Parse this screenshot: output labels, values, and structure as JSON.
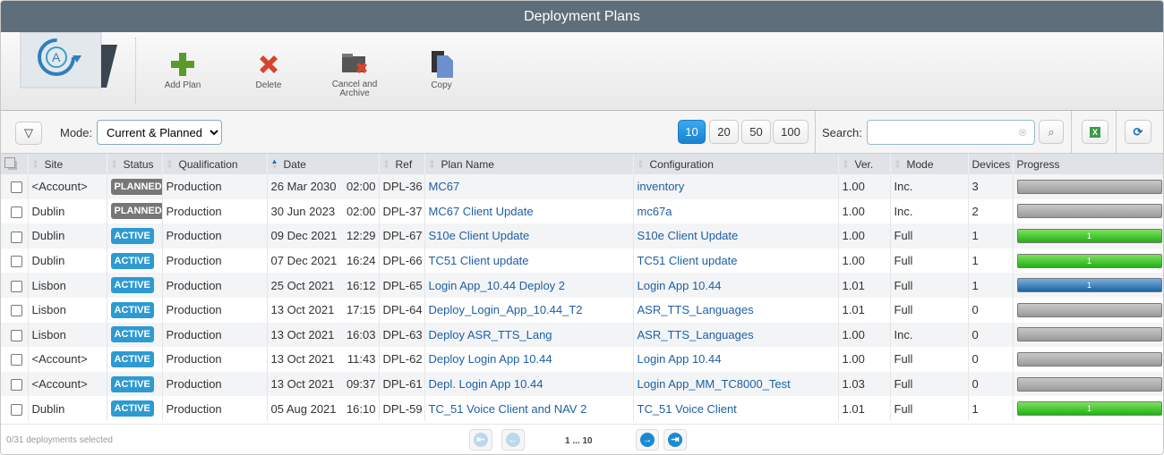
{
  "window": {
    "title": "Deployment Plans"
  },
  "toolbar": {
    "add": "Add Plan",
    "delete": "Delete",
    "cancel_archive": "Cancel and Archive",
    "copy": "Copy"
  },
  "filter": {
    "mode_label": "Mode:",
    "mode_value": "Current & Planned",
    "page_sizes": [
      "10",
      "20",
      "50",
      "100"
    ],
    "active_page_size": "10",
    "search_label": "Search:",
    "search_value": ""
  },
  "columns": [
    "Site",
    "Status",
    "Qualification",
    "Date",
    "Ref",
    "Plan Name",
    "Configuration",
    "Ver.",
    "Mode",
    "Devices",
    "Progress"
  ],
  "rows": [
    {
      "site": "<Account>",
      "status": "PLANNED",
      "qual": "Production",
      "date": "26 Mar 2030",
      "time": "02:00",
      "ref": "DPL-36",
      "plan": "MC67",
      "config": "inventory",
      "ver": "1.00",
      "mode": "Inc.",
      "devices": "3",
      "progress": {
        "state": "none",
        "fraction": 0,
        "label": ""
      }
    },
    {
      "site": "Dublin",
      "status": "PLANNED",
      "qual": "Production",
      "date": "30 Jun 2023",
      "time": "02:00",
      "ref": "DPL-37",
      "plan": "MC67 Client Update",
      "config": "mc67a",
      "ver": "1.00",
      "mode": "Inc.",
      "devices": "2",
      "progress": {
        "state": "none",
        "fraction": 0,
        "label": ""
      }
    },
    {
      "site": "Dublin",
      "status": "ACTIVE",
      "qual": "Production",
      "date": "09 Dec 2021",
      "time": "12:29",
      "ref": "DPL-67",
      "plan": "S10e Client Update",
      "config": "S10e Client Update",
      "ver": "1.00",
      "mode": "Full",
      "devices": "1",
      "progress": {
        "state": "green",
        "fraction": 1,
        "label": "1"
      }
    },
    {
      "site": "Dublin",
      "status": "ACTIVE",
      "qual": "Production",
      "date": "07 Dec 2021",
      "time": "16:24",
      "ref": "DPL-66",
      "plan": "TC51 Client update",
      "config": "TC51 Client update",
      "ver": "1.00",
      "mode": "Full",
      "devices": "1",
      "progress": {
        "state": "green",
        "fraction": 1,
        "label": "1"
      }
    },
    {
      "site": "Lisbon",
      "status": "ACTIVE",
      "qual": "Production",
      "date": "25 Oct 2021",
      "time": "16:12",
      "ref": "DPL-65",
      "plan": "Login App_10.44 Deploy 2",
      "config": "Login App 10.44",
      "ver": "1.01",
      "mode": "Full",
      "devices": "1",
      "progress": {
        "state": "blue",
        "fraction": 1,
        "label": "1"
      }
    },
    {
      "site": "Lisbon",
      "status": "ACTIVE",
      "qual": "Production",
      "date": "13 Oct 2021",
      "time": "17:15",
      "ref": "DPL-64",
      "plan": "Deploy_Login_App_10.44_T2",
      "config": "ASR_TTS_Languages",
      "ver": "1.01",
      "mode": "Full",
      "devices": "0",
      "progress": {
        "state": "none",
        "fraction": 0,
        "label": ""
      }
    },
    {
      "site": "Lisbon",
      "status": "ACTIVE",
      "qual": "Production",
      "date": "13 Oct 2021",
      "time": "16:03",
      "ref": "DPL-63",
      "plan": "Deploy ASR_TTS_Lang",
      "config": "ASR_TTS_Languages",
      "ver": "1.00",
      "mode": "Inc.",
      "devices": "0",
      "progress": {
        "state": "none",
        "fraction": 0,
        "label": ""
      }
    },
    {
      "site": "<Account>",
      "status": "ACTIVE",
      "qual": "Production",
      "date": "13 Oct 2021",
      "time": "11:43",
      "ref": "DPL-62",
      "plan": "Deploy Login App 10.44",
      "config": "Login App 10.44",
      "ver": "1.00",
      "mode": "Full",
      "devices": "0",
      "progress": {
        "state": "none",
        "fraction": 0,
        "label": ""
      }
    },
    {
      "site": "<Account>",
      "status": "ACTIVE",
      "qual": "Production",
      "date": "13 Oct 2021",
      "time": "09:37",
      "ref": "DPL-61",
      "plan": "Depl. Login App 10.44",
      "config": "Login App_MM_TC8000_Test",
      "ver": "1.03",
      "mode": "Full",
      "devices": "0",
      "progress": {
        "state": "none",
        "fraction": 0,
        "label": ""
      }
    },
    {
      "site": "Dublin",
      "status": "ACTIVE",
      "qual": "Production",
      "date": "05 Aug 2021",
      "time": "16:10",
      "ref": "DPL-59",
      "plan": "TC_51 Voice Client and NAV 2",
      "config": "TC_51 Voice Client",
      "ver": "1.01",
      "mode": "Full",
      "devices": "1",
      "progress": {
        "state": "green",
        "fraction": 1,
        "label": "1"
      }
    }
  ],
  "footer": {
    "selected": "0/31 deployments selected",
    "pages": "1 ... 10"
  },
  "colors": {
    "titlebar": "#5f6e7b",
    "active": "#2e9ad2",
    "planned": "#777777",
    "link": "#1d5fa5"
  }
}
